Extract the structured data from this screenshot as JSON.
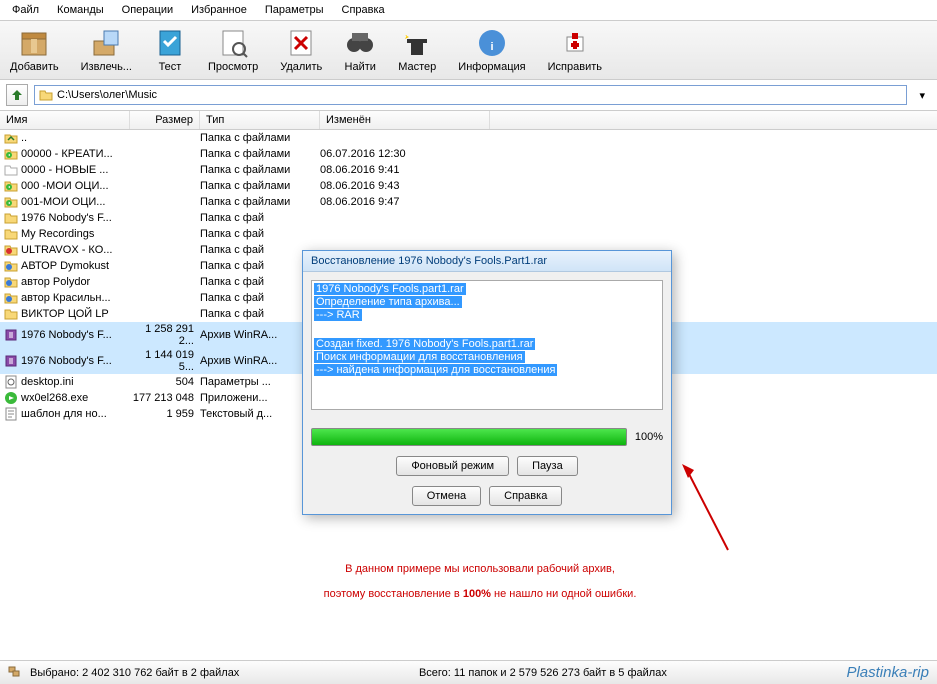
{
  "menu": {
    "file": "Файл",
    "commands": "Команды",
    "operations": "Операции",
    "favorites": "Избранное",
    "params": "Параметры",
    "help": "Справка"
  },
  "toolbar": {
    "add": "Добавить",
    "extract": "Извлечь...",
    "test": "Тест",
    "view": "Просмотр",
    "delete": "Удалить",
    "find": "Найти",
    "wizard": "Мастер",
    "info": "Информация",
    "repair": "Исправить"
  },
  "path": "C:\\Users\\олег\\Music",
  "cols": {
    "name": "Имя",
    "size": "Размер",
    "type": "Тип",
    "mod": "Изменён"
  },
  "types": {
    "folder": "Папка с файлами",
    "rar": "Архив WinRA...",
    "ini": "Параметры ...",
    "exe": "Приложени...",
    "txt": "Текстовый д..."
  },
  "files": [
    {
      "icon": "up",
      "name": "..",
      "size": "",
      "type": "Папка с файлами",
      "mod": ""
    },
    {
      "icon": "fold-g",
      "name": "00000 - КРЕАТИ...",
      "size": "",
      "type": "Папка с файлами",
      "mod": "06.07.2016 12:30"
    },
    {
      "icon": "fold-w",
      "name": "0000 - НОВЫЕ ...",
      "size": "",
      "type": "Папка с файлами",
      "mod": "08.06.2016 9:41"
    },
    {
      "icon": "fold-g",
      "name": "000 -МОИ ОЦИ...",
      "size": "",
      "type": "Папка с файлами",
      "mod": "08.06.2016 9:43"
    },
    {
      "icon": "fold-g",
      "name": "001-МОИ ОЦИ...",
      "size": "",
      "type": "Папка с файлами",
      "mod": "08.06.2016 9:47"
    },
    {
      "icon": "fold",
      "name": "1976 Nobody's F...",
      "size": "",
      "type": "Папка с фай",
      "mod": ""
    },
    {
      "icon": "fold",
      "name": "My Recordings",
      "size": "",
      "type": "Папка с фай",
      "mod": ""
    },
    {
      "icon": "fold-r",
      "name": "ULTRAVOX - КО...",
      "size": "",
      "type": "Папка с фай",
      "mod": ""
    },
    {
      "icon": "fold-b",
      "name": "АВТОР Dymokust",
      "size": "",
      "type": "Папка с фай",
      "mod": ""
    },
    {
      "icon": "fold-b",
      "name": "автор Polydor",
      "size": "",
      "type": "Папка с фай",
      "mod": ""
    },
    {
      "icon": "fold-b",
      "name": "автор Красильн...",
      "size": "",
      "type": "Папка с фай",
      "mod": ""
    },
    {
      "icon": "fold",
      "name": "ВИКТОР ЦОЙ LP",
      "size": "",
      "type": "Папка с фай",
      "mod": ""
    },
    {
      "icon": "rar",
      "name": "1976 Nobody's F...",
      "size": "1 258 291 2...",
      "type": "Архив WinRA...",
      "mod": "",
      "sel": true
    },
    {
      "icon": "rar",
      "name": "1976 Nobody's F...",
      "size": "1 144 019 5...",
      "type": "Архив WinRA...",
      "mod": "",
      "sel": true
    },
    {
      "icon": "ini",
      "name": "desktop.ini",
      "size": "504",
      "type": "Параметры ...",
      "mod": ""
    },
    {
      "icon": "exe",
      "name": "wx0el268.exe",
      "size": "177 213 048",
      "type": "Приложени...",
      "mod": ""
    },
    {
      "icon": "txt",
      "name": "шаблон для но...",
      "size": "1 959",
      "type": "Текстовый д...",
      "mod": ""
    }
  ],
  "dialog": {
    "title": "Восстановление 1976 Nobody's Fools.Part1.rar",
    "log": [
      "1976 Nobody's Fools.part1.rar",
      "Определение типа архива...",
      "---> RAR",
      "",
      "Создан fixed. 1976 Nobody's Fools.part1.rar",
      "Поиск информации для восстановления",
      "---> найдена информация для восстановления"
    ],
    "progress": "100%",
    "btns": {
      "bg": "Фоновый режим",
      "pause": "Пауза",
      "cancel": "Отмена",
      "help": "Справка"
    }
  },
  "caption": {
    "l1a": "В данном примере мы использовали рабочий архив,",
    "l2a": "поэтому восстановление в ",
    "l2b": "100%",
    "l2c": " не нашло ни одной ошибки."
  },
  "status": {
    "left": "Выбрано: 2 402 310 762 байт в 2 файлах",
    "right": "Всего: 11 папок и 2 579 526 273 байт в 5 файлах",
    "wm": "Plastinka-rip"
  }
}
